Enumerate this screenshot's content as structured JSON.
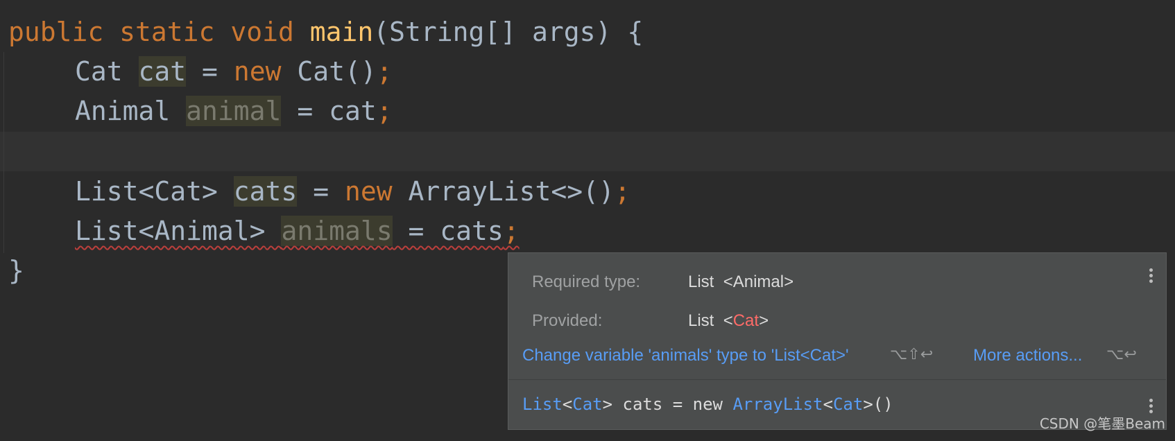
{
  "code": {
    "line1": {
      "kw_public": "public",
      "kw_static": "static",
      "kw_void": "void",
      "method": "main",
      "params": "(String[] args) {"
    },
    "line2": {
      "type": "Cat",
      "var": "cat",
      "eq": " = ",
      "kw_new": "new",
      "ctor": " Cat()",
      "semi": ";"
    },
    "line3": {
      "type": "Animal",
      "var": "animal",
      "eq": " = cat",
      "semi": ";"
    },
    "line5": {
      "type": "List<Cat>",
      "var": "cats",
      "eq": " = ",
      "kw_new": "new",
      "ctor": " ArrayList<>()",
      "semi": ";"
    },
    "line6": {
      "type": "List<Animal>",
      "var": "animals",
      "eq": " = cats",
      "semi": ";"
    },
    "closing": "}"
  },
  "popup": {
    "required_label": "Required type:",
    "required_type": "List",
    "required_generic": "<Animal>",
    "provided_label": "Provided:",
    "provided_type": "List",
    "provided_lt": "<",
    "provided_generic": "Cat",
    "provided_gt": ">",
    "fix_action": "Change variable 'animals' type to 'List<Cat>'",
    "fix_shortcut": "⌥⇧↩",
    "more_actions": "More actions...",
    "more_shortcut": "⌥↩",
    "signature": {
      "list": "List",
      "lt": "<",
      "cat": "Cat",
      "gt_rest": "> cats = new ",
      "arraylist": "ArrayList",
      "lt2": "<",
      "cat2": "Cat",
      "end": ">()"
    }
  },
  "watermark": "CSDN @笔墨Beam",
  "colors": {
    "keyword": "#cc7832",
    "method": "#ffc66d",
    "text": "#a9b7c6",
    "error": "#bc3f3c",
    "link": "#589df6",
    "background": "#2b2b2b"
  }
}
